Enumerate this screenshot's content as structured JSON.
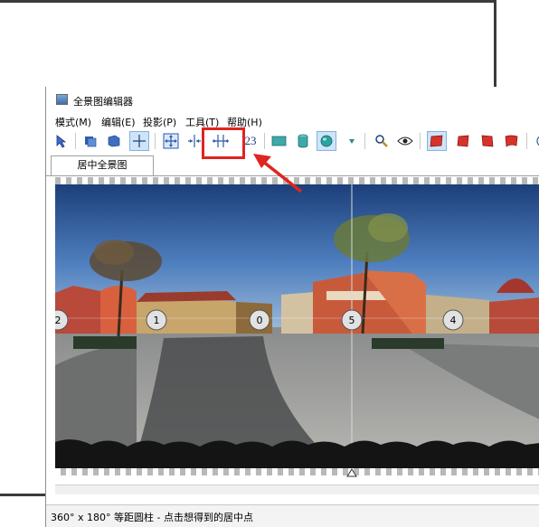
{
  "window": {
    "title": "全景图编辑器"
  },
  "menu": [
    "模式(M)",
    "编辑(E)",
    "投影(P)",
    "工具(T)",
    "帮助(H)"
  ],
  "toolbar": {
    "number_button_label": "23"
  },
  "tab": {
    "label": "居中全景图"
  },
  "viewer": {
    "markers": [
      "2",
      "1",
      "0",
      "5",
      "4"
    ]
  },
  "status": {
    "text": "360° x 180° 等距圆柱 - 点击想得到的居中点"
  }
}
